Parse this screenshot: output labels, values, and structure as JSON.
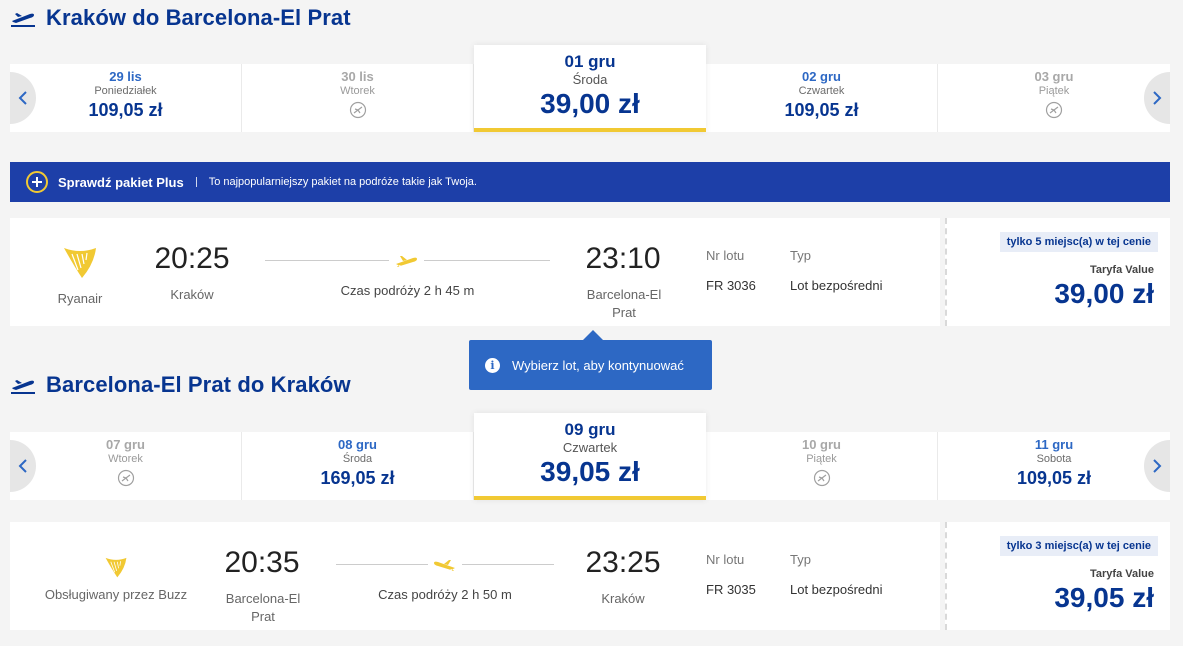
{
  "outbound": {
    "title": "Kraków do Barcelona-El Prat",
    "dates": [
      {
        "date": "29 lis",
        "weekday": "Poniedziałek",
        "price": "109,05 zł"
      },
      {
        "date": "30 lis",
        "weekday": "Wtorek",
        "price": ""
      },
      {
        "date": "01 gru",
        "weekday": "Środa",
        "price": "39,00 zł"
      },
      {
        "date": "02 gru",
        "weekday": "Czwartek",
        "price": "109,05 zł"
      },
      {
        "date": "03 gru",
        "weekday": "Piątek",
        "price": ""
      }
    ],
    "flight": {
      "airline": "Ryanair",
      "depart_time": "20:25",
      "depart_city": "Kraków",
      "duration": "Czas podróży 2 h 45 m",
      "arrive_time": "23:10",
      "arrive_city": "Barcelona-El Prat",
      "flight_no_label": "Nr lotu",
      "flight_no": "FR 3036",
      "type_label": "Typ",
      "type": "Lot bezpośredni",
      "seats": "tylko 5 miejsc(a) w tej cenie",
      "fare_name": "Taryfa Value",
      "fare_price": "39,00 zł"
    }
  },
  "promo": {
    "title": "Sprawdź pakiet Plus",
    "description": "To najpopularniejszy pakiet na podróże takie jak Twoja."
  },
  "toast": {
    "message": "Wybierz lot, aby kontynuować"
  },
  "inbound": {
    "title": "Barcelona-El Prat do Kraków",
    "dates": [
      {
        "date": "07 gru",
        "weekday": "Wtorek",
        "price": ""
      },
      {
        "date": "08 gru",
        "weekday": "Środa",
        "price": "169,05 zł"
      },
      {
        "date": "09 gru",
        "weekday": "Czwartek",
        "price": "39,05 zł"
      },
      {
        "date": "10 gru",
        "weekday": "Piątek",
        "price": ""
      },
      {
        "date": "11 gru",
        "weekday": "Sobota",
        "price": "109,05 zł"
      }
    ],
    "flight": {
      "airline": "Obsługiwany przez Buzz",
      "depart_time": "20:35",
      "depart_city": "Barcelona-El Prat",
      "duration": "Czas podróży 2 h 50 m",
      "arrive_time": "23:25",
      "arrive_city": "Kraków",
      "flight_no_label": "Nr lotu",
      "flight_no": "FR 3035",
      "type_label": "Typ",
      "type": "Lot bezpośredni",
      "seats": "tylko 3 miejsc(a) w tej cenie",
      "fare_name": "Taryfa Value",
      "fare_price": "39,05 zł"
    }
  },
  "icons": {
    "section": "plane-departure-icon",
    "no_flight": "no-flight-icon",
    "promo": "plus-circle-icon",
    "info": "info-icon",
    "logo": "ryanair-harp-icon"
  },
  "colors": {
    "brand_blue": "#073590",
    "accent_yellow": "#f1c933",
    "link_blue": "#2d68c4",
    "promo_bg": "#1d3fa8"
  }
}
